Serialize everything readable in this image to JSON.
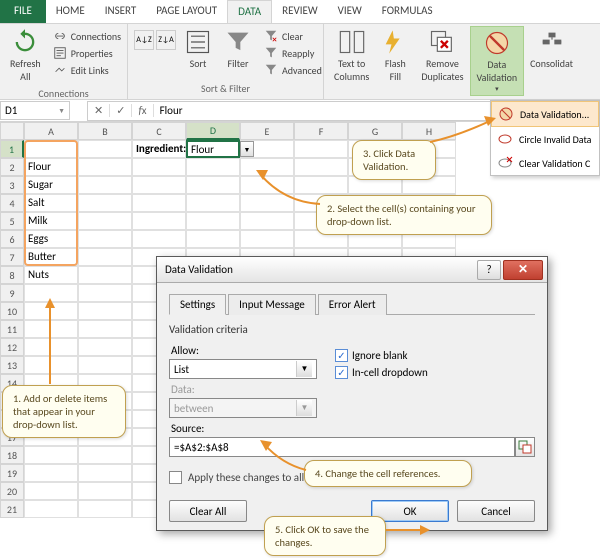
{
  "tabs": {
    "file": "FILE",
    "home": "HOME",
    "insert": "INSERT",
    "pagelayout": "PAGE LAYOUT",
    "data": "DATA",
    "review": "REVIEW",
    "view": "VIEW",
    "formulas": "FORMULAS"
  },
  "ribbon": {
    "refresh": "Refresh\nAll",
    "connections": "Connections",
    "properties": "Properties",
    "editlinks": "Edit Links",
    "group_conn": "Connections",
    "sort": "Sort",
    "filter": "Filter",
    "clear": "Clear",
    "reapply": "Reapply",
    "advanced": "Advanced",
    "group_sf": "Sort & Filter",
    "text2col": "Text to\nColumns",
    "flash": "Flash\nFill",
    "removedup": "Remove\nDuplicates",
    "dataval": "Data\nValidation",
    "consol": "Consolidat"
  },
  "dv_menu": {
    "dv": "Data Validation...",
    "circle": "Circle Invalid Data",
    "clear": "Clear Validation C"
  },
  "namebox": "D1",
  "fx_val": "Flour",
  "cols": [
    "A",
    "B",
    "C",
    "D",
    "E",
    "F",
    "G",
    "H"
  ],
  "rownums": [
    "1",
    "2",
    "3",
    "4",
    "5",
    "6",
    "7",
    "8",
    "9",
    "10",
    "11",
    "12",
    "13",
    "14",
    "15",
    "16",
    "17",
    "18",
    "19",
    "20",
    "21"
  ],
  "sheet": {
    "c1": "Ingredient:",
    "d1": "Flour",
    "a": [
      "Flour",
      "Sugar",
      "Salt",
      "Milk",
      "Eggs",
      "Butter",
      "Nuts"
    ]
  },
  "callouts": {
    "c1": "1. Add or delete items that appear in your drop-down list.",
    "c2": "2. Select the cell(s) containing your drop-down list.",
    "c3": "3. Click Data Validation.",
    "c4": "4. Change the cell references.",
    "c5": "5. Click OK to save the changes."
  },
  "dialog": {
    "title": "Data Validation",
    "tabs": {
      "settings": "Settings",
      "input": "Input Message",
      "error": "Error Alert"
    },
    "criteria": "Validation criteria",
    "allow": "Allow:",
    "allow_val": "List",
    "data": "Data:",
    "data_val": "between",
    "ignore": "Ignore blank",
    "incell": "In-cell dropdown",
    "source": "Source:",
    "source_val": "=$A$2:$A$8",
    "apply": "Apply these changes to all other cells with the same settings",
    "clearall": "Clear All",
    "ok": "OK",
    "cancel": "Cancel"
  }
}
